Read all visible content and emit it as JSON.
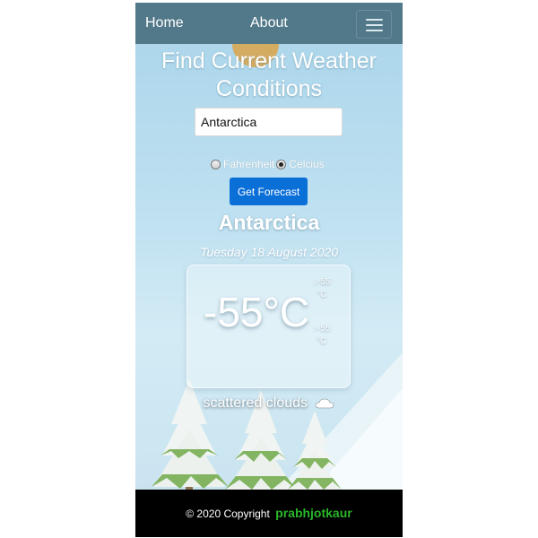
{
  "navbar": {
    "home_label": "Home",
    "about_label": "About",
    "menu_icon": "hamburger-menu-icon"
  },
  "main": {
    "heading": "Find Current Weather Conditions",
    "city_input_value": "Antarctica",
    "units": {
      "options": [
        {
          "label": "Fahrenheit",
          "selected": false
        },
        {
          "label": "Celcius",
          "selected": true
        }
      ]
    },
    "forecast_button_label": "Get Forecast",
    "city_name": "Antarctica",
    "date": "Tuesday 18 August 2020",
    "temperature": {
      "current": "-55°C",
      "max_value": "-55",
      "max_unit": "°C",
      "max_arrow": "↓",
      "min_value": "-55",
      "min_unit": "°C",
      "min_arrow": "↑"
    },
    "description": "scattered clouds",
    "description_icon": "cloud-icon"
  },
  "footer": {
    "copyright": "© 2020 Copyright",
    "author": "prabhjotkaur",
    "author_color": "#2bb52b"
  },
  "colors": {
    "navbar": "#52798a",
    "button": "#0b6fd8",
    "footer": "#000000"
  }
}
